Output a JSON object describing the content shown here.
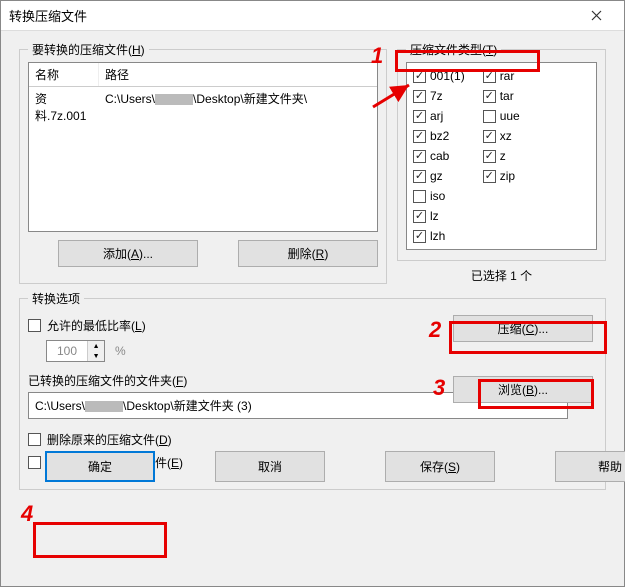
{
  "window": {
    "title": "转换压缩文件"
  },
  "fileGroup": {
    "label": "要转换的压缩文件(",
    "labelKey": "H",
    "labelEnd": ")",
    "colName": "名称",
    "colPath": "路径",
    "row": {
      "name": "资料.7z.001",
      "pathPrefix": "C:\\Users\\",
      "pathSuffix": "\\Desktop\\新建文件夹\\"
    },
    "addBtn": "添加(A)...",
    "delBtn": "删除(R)"
  },
  "typeGroup": {
    "label": "压缩文件类型(",
    "labelKey": "T",
    "labelEnd": ")",
    "col1": [
      {
        "label": "001(1)",
        "checked": true
      },
      {
        "label": "7z",
        "checked": true
      },
      {
        "label": "arj",
        "checked": true
      },
      {
        "label": "bz2",
        "checked": true
      },
      {
        "label": "cab",
        "checked": true
      },
      {
        "label": "gz",
        "checked": true
      },
      {
        "label": "iso",
        "checked": false
      },
      {
        "label": "lz",
        "checked": true
      },
      {
        "label": "lzh",
        "checked": true
      }
    ],
    "col2": [
      {
        "label": "rar",
        "checked": true
      },
      {
        "label": "tar",
        "checked": true
      },
      {
        "label": "uue",
        "checked": false
      },
      {
        "label": "xz",
        "checked": true
      },
      {
        "label": "z",
        "checked": true
      },
      {
        "label": "zip",
        "checked": true
      }
    ],
    "selectedCount": "已选择 1 个"
  },
  "options": {
    "label": "转换选项",
    "allowRatio": "允许的最低比率(",
    "allowRatioKey": "L",
    "allowRatioEnd": ")",
    "ratioValue": "100",
    "pct": "%",
    "compressBtn": "压缩(C)...",
    "folderLabel": "已转换的压缩文件的文件夹(",
    "folderLabelKey": "F",
    "folderLabelEnd": ")",
    "browseBtn": "浏览(B)...",
    "folderPrefix": "C:\\Users\\",
    "folderSuffix": "\\Desktop\\新建文件夹 (3)",
    "deleteOrig": "删除原来的压缩文件(",
    "deleteOrigKey": "D",
    "deleteOrigEnd": ")",
    "ignoreEnc": "忽略已加密的压缩文件(",
    "ignoreEncKey": "E",
    "ignoreEncEnd": ")"
  },
  "buttons": {
    "ok": "确定",
    "cancel": "取消",
    "save": "保存(S)",
    "help": "帮助"
  },
  "anno": {
    "n1": "1",
    "n2": "2",
    "n3": "3",
    "n4": "4"
  }
}
